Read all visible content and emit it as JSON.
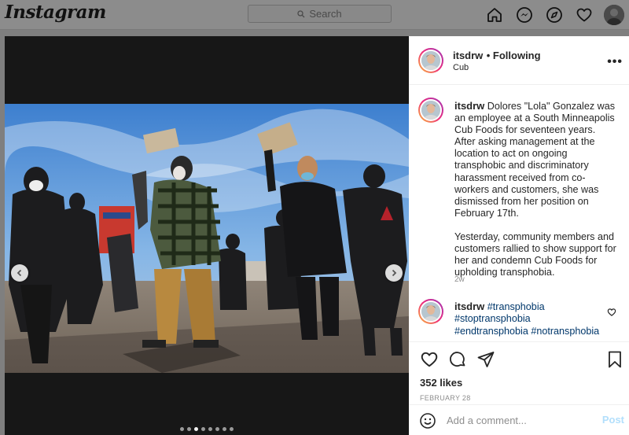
{
  "nav": {
    "logo": "Instagram",
    "search_placeholder": "Search",
    "icons": [
      "home-icon",
      "messenger-icon",
      "explore-icon",
      "heart-icon",
      "profile-avatar"
    ]
  },
  "post": {
    "username": "itsdrw",
    "follow_status": "• Following",
    "location": "Cub",
    "more_label": "•••",
    "caption_username": "itsdrw",
    "caption_p1": "Dolores \"Lola\" Gonzalez was an employee at a South Minneapolis Cub Foods for seventeen years. After asking management at the location to act on ongoing transphobic and discriminatory harassment received from co-workers and customers, she was dismissed from her position on February 17th.",
    "caption_p2": "Yesterday, community members and customers rallied to show support for her and condemn Cub Foods for upholding transphobia.",
    "caption_time": "2w",
    "comment_username": "itsdrw",
    "hashtags": [
      "#transphobia",
      "#stoptransphobia",
      "#endtransphobia",
      "#notransphobia"
    ],
    "likes": "352 likes",
    "date": "FEBRUARY 28",
    "comment_placeholder": "Add a comment...",
    "post_label": "Post",
    "carousel": {
      "count": 8,
      "active_index": 2
    }
  },
  "colors": {
    "link": "#00376b",
    "post_button_disabled": "#b2dffc",
    "muted": "#8e8e8e"
  }
}
